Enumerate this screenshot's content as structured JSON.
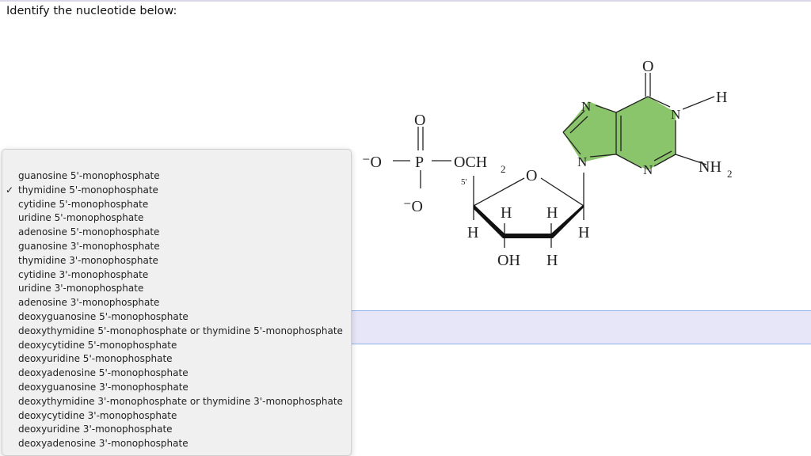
{
  "question": "Identify the nucleotide below:",
  "molecule": {
    "labels": {
      "phosphate_o_top": "O",
      "phosphate_p": "P",
      "phosphate_o_left": "⁻O",
      "phosphate_o_bottom": "⁻O",
      "och2": "OCH",
      "och2_sub": "2",
      "five_prime": "5'",
      "ring_o": "O",
      "h1": "H",
      "h2": "H",
      "h3": "H",
      "h4": "H",
      "oh": "OH",
      "h5": "H",
      "n7": "N",
      "n9": "N",
      "n3": "N",
      "n1": "N",
      "carbonyl_o": "O",
      "n1_h": "H",
      "nh2": "NH",
      "nh2_sub": "2"
    },
    "base_color": "#8bc56b"
  },
  "dropdown": {
    "selected_index": 1,
    "check_mark": "✓",
    "options": [
      "guanosine 5'-monophosphate",
      "thymidine 5'-monophosphate",
      "cytidine 5'-monophosphate",
      "uridine 5'-monophosphate",
      "adenosine 5'-monophosphate",
      "guanosine 3'-monophosphate",
      "thymidine 3'-monophosphate",
      "cytidine 3'-monophosphate",
      "uridine 3'-monophosphate",
      "adenosine 3'-monophosphate",
      "deoxyguanosine 5'-monophosphate",
      "deoxythymidine 5'-monophosphate or thymidine 5'-monophosphate",
      "deoxycytidine 5'-monophosphate",
      "deoxyuridine 5'-monophosphate",
      "deoxyadenosine 5'-monophosphate",
      "deoxyguanosine 3'-monophosphate",
      "deoxythymidine 3'-monophosphate or thymidine 3'-monophosphate",
      "deoxycytidine 3'-monophosphate",
      "deoxyuridine 3'-monophosphate",
      "deoxyadenosine 3'-monophosphate"
    ]
  }
}
